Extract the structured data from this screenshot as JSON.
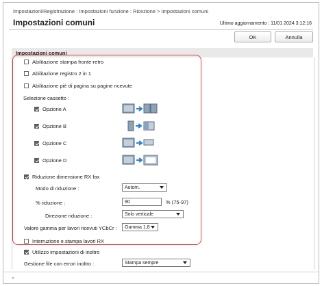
{
  "breadcrumb": "Impostazioni/Registrazione : Impostazioni funzione : Ricezione > Impostazioni comuni",
  "title": "Impostazioni comuni",
  "last_update": "Ultimo aggiornamento : 11/01 2024 3:12:16",
  "buttons": {
    "ok": "OK",
    "cancel": "Annulla"
  },
  "section_title": "Impostazioni comuni",
  "options": {
    "duplex": {
      "label": "Abilitazione stampa fronte-retro",
      "checked": false
    },
    "log2in1": {
      "label": "Abilitazione registro 2 in 1",
      "checked": false
    },
    "footer": {
      "label": "Abilitazione piè di pagina su pagine ricevute",
      "checked": false
    }
  },
  "drawer": {
    "label": "Selezione cassetto :",
    "items": [
      {
        "label": "Opzione A",
        "checked": true
      },
      {
        "label": "Opzione B",
        "checked": true
      },
      {
        "label": "Opzione C",
        "checked": true
      },
      {
        "label": "Opzione D",
        "checked": true
      }
    ]
  },
  "reduction": {
    "label": "Riduzione dimensione RX fax",
    "checked": true,
    "mode_label": "Modo di riduzione :",
    "mode_value": "Autom.",
    "percent_label": "% riduzione :",
    "percent_value": "90",
    "percent_range": "% (75-97)",
    "direction_label": "Direzione riduzione :",
    "direction_value": "Solo verticale"
  },
  "gamma": {
    "label": "Valore gamma per lavori ricevuti YCbCr :",
    "value": "Gamma 1,8"
  },
  "interrupt": {
    "label": "Interruzione e stampa lavori RX",
    "checked": false
  },
  "forward": {
    "label": "Utilizzo impostazioni di inoltro",
    "checked": true
  },
  "error_files": {
    "label": "Gestione file con errori inoltro :",
    "value": "Stampa sempre"
  }
}
